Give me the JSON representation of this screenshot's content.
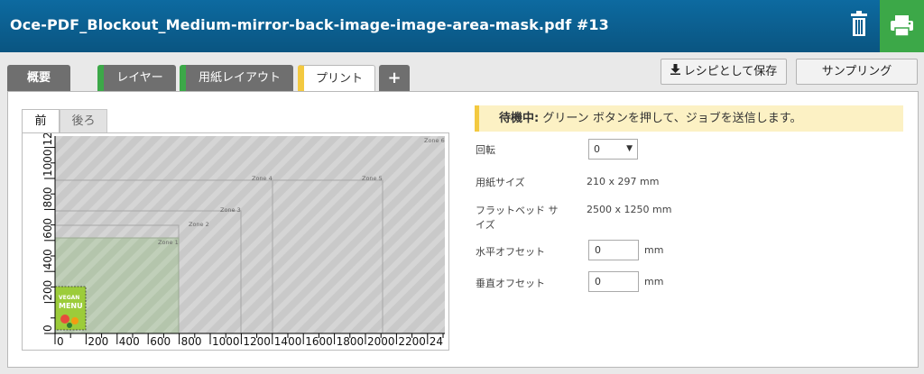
{
  "header": {
    "title": "Oce-PDF_Blockout_Medium-mirror-back-image-image-area-mask.pdf #13",
    "trash_icon": "trash-icon",
    "print_icon": "printer-icon"
  },
  "tabs": [
    {
      "label": "概要"
    },
    {
      "label": "レイヤー"
    },
    {
      "label": "用紙レイアウト"
    },
    {
      "label": "プリント"
    },
    {
      "label": "+"
    }
  ],
  "buttons": {
    "save_recipe": "レシピとして保存",
    "sampling": "サンプリング"
  },
  "preview": {
    "subtabs": {
      "front": "前",
      "back": "後ろ"
    },
    "zones": [
      "Zone 1",
      "Zone 2",
      "Zone 3",
      "Zone 4",
      "Zone 5",
      "Zone 6"
    ],
    "x_ticks": [
      "0",
      "200",
      "400",
      "600",
      "800",
      "1000",
      "1200",
      "1400",
      "1600",
      "1800",
      "2000",
      "2200",
      "24"
    ],
    "y_ticks": [
      "0",
      "200",
      "400",
      "600",
      "800",
      "1000",
      "1200"
    ],
    "thumbnail_text": [
      "VEGAN",
      "MENU"
    ]
  },
  "status": {
    "prefix": "待機中:",
    "message": " グリーン ボタンを押して、ジョブを送信します。"
  },
  "fields": {
    "rotation_label": "回転",
    "rotation_value": "0",
    "paper_size_label": "用紙サイズ",
    "paper_size_value": "210 x 297 mm",
    "flatbed_size_label_1": "フラットベッド サ",
    "flatbed_size_label_2": "イズ",
    "flatbed_size_value": "2500 x 1250 mm",
    "h_offset_label": "水平オフセット",
    "h_offset_value": "0",
    "v_offset_label": "垂直オフセット",
    "v_offset_value": "0",
    "unit": "mm"
  },
  "colors": {
    "header_blue": "#0a5e8f",
    "green": "#3ca848",
    "yellow": "#f3c940",
    "tab_gray": "#6f6f6f"
  }
}
